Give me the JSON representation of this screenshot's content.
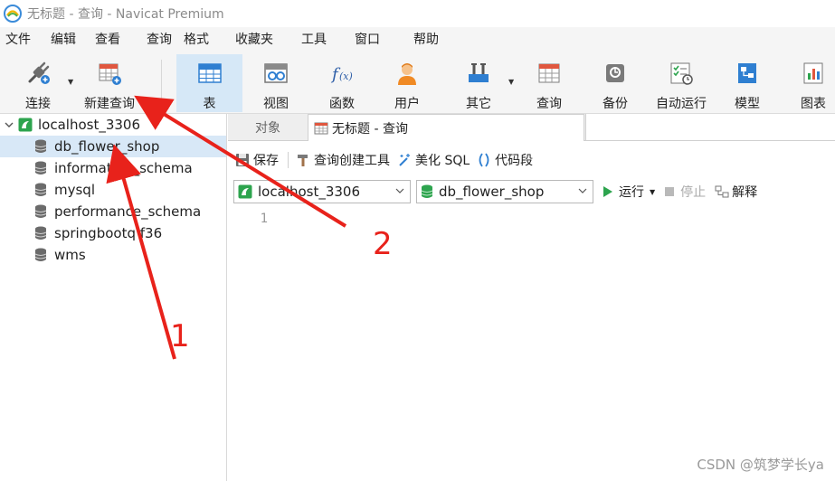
{
  "window": {
    "title": "无标题 - 查询 - Navicat Premium"
  },
  "menu": [
    "文件",
    "编辑",
    "查看",
    "查询",
    "格式",
    "收藏夹",
    "工具",
    "窗口",
    "帮助"
  ],
  "toolbar": {
    "connect": "连接",
    "new_query": "新建查询",
    "table": "表",
    "view": "视图",
    "function": "函数",
    "user": "用户",
    "other": "其它",
    "query": "查询",
    "backup": "备份",
    "automation": "自动运行",
    "model": "模型",
    "chart": "图表"
  },
  "sidebar": {
    "connection": "localhost_3306",
    "databases": [
      "db_flower_shop",
      "information_schema",
      "mysql",
      "performance_schema",
      "springbootq f36",
      "wms"
    ],
    "selected_index": 0
  },
  "tabs": {
    "objects": "对象",
    "query": "无标题 - 查询"
  },
  "query_toolbar": {
    "save": "保存",
    "builder": "查询创建工具",
    "beautify": "美化 SQL",
    "snippet": "代码段"
  },
  "connection_bar": {
    "connection": "localhost_3306",
    "database": "db_flower_shop",
    "run": "运行",
    "stop": "停止",
    "explain": "解释"
  },
  "editor": {
    "line_number": "1"
  },
  "annotations": {
    "label_1": "1",
    "label_2": "2",
    "color": "#e8221b"
  },
  "watermark": "CSDN @筑梦学长ya",
  "colors": {
    "accent": "#2f7fd1",
    "selected_bg": "#d8e8f7",
    "green": "#2da44e"
  }
}
